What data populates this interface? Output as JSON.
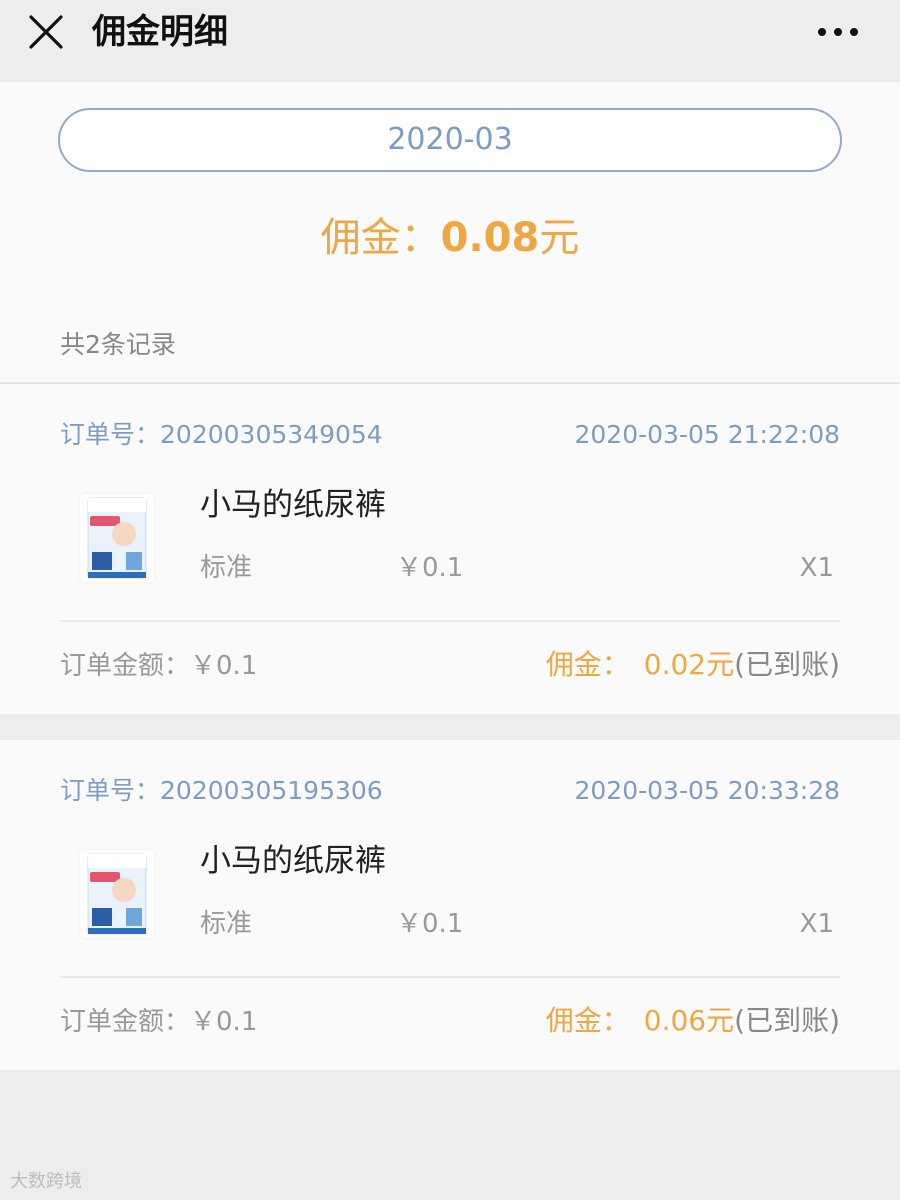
{
  "header": {
    "title": "佣金明细",
    "close_icon": "close-icon",
    "more_icon": "more-dots-icon"
  },
  "summary": {
    "month": "2020-03",
    "commission_label": "佣金：",
    "commission_value": "0.08",
    "commission_unit": "元",
    "record_count": "共2条记录"
  },
  "orders": [
    {
      "order_label": "订单号：",
      "order_no": "20200305349054",
      "time": "2020-03-05 21:22:08",
      "product_name": "小马的纸尿裤",
      "spec": "标准",
      "price": "￥0.1",
      "qty": "X1",
      "amount_label": "订单金额：",
      "amount": "￥0.1",
      "commission_label": "佣金：",
      "commission": "0.02元",
      "status": "(已到账)"
    },
    {
      "order_label": "订单号：",
      "order_no": "20200305195306",
      "time": "2020-03-05 20:33:28",
      "product_name": "小马的纸尿裤",
      "spec": "标准",
      "price": "￥0.1",
      "qty": "X1",
      "amount_label": "订单金额：",
      "amount": "￥0.1",
      "commission_label": "佣金：",
      "commission": "0.06元",
      "status": "(已到账)"
    }
  ],
  "watermark": "大数跨境",
  "colors": {
    "accent_orange": "#efa744",
    "link_blue": "#7e9dc2",
    "background": "#ededed"
  }
}
